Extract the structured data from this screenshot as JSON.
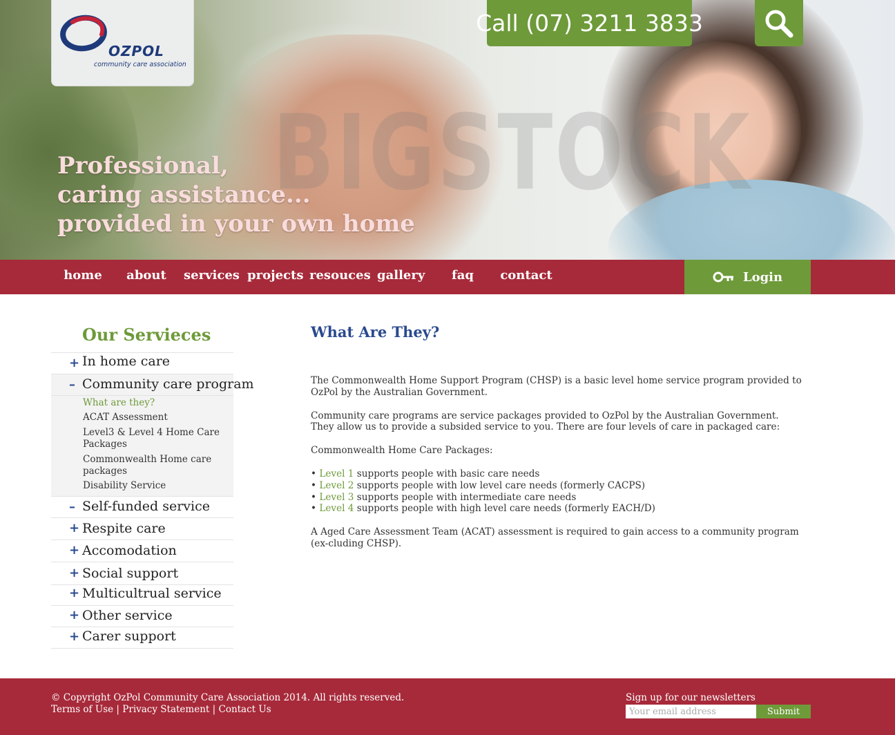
{
  "header": {
    "logo_name": "OZPOL",
    "logo_sub": "community care association",
    "call": "Call (07) 3211 3833",
    "watermark": "BIGSTOCK"
  },
  "hero": {
    "tagline": [
      "Professional,",
      "caring assistance...",
      "provided in your own home"
    ]
  },
  "nav": {
    "items": [
      "home",
      "about",
      "services",
      "projects",
      "resouces",
      "gallery",
      "faq",
      "contact"
    ],
    "login": "Login"
  },
  "sidebar": {
    "title": "Our Servieces",
    "items": [
      {
        "sign": "+",
        "label": "In home care"
      },
      {
        "sign": "–",
        "label": "Community care program"
      },
      {
        "sign": "–",
        "label": "Self-funded service"
      },
      {
        "sign": "+",
        "label": "Respite care"
      },
      {
        "sign": "+",
        "label": "Accomodation"
      },
      {
        "sign": "+",
        "label": "Social support"
      },
      {
        "sign": "+",
        "label": "Multicultrual service"
      },
      {
        "sign": "+",
        "label": "Other service"
      },
      {
        "sign": "+",
        "label": "Carer support"
      }
    ],
    "subitems": [
      "What are they?",
      "ACAT Assessment",
      "Level3 & Level 4 Home Care Packages",
      "Commonwealth Home care packages",
      "Disability Service"
    ]
  },
  "content": {
    "title": "What Are They?",
    "p1": "The Commonwealth Home Support Program (CHSP) is a basic level home service program provided to OzPol by the Australian Government.",
    "p2": "Community care programs are service packages provided to OzPol by the Australian Government.  They allow us to provide a subsided service to you.  There are four levels of care in packaged care:",
    "p3": "Commonwealth Home Care Packages:",
    "levels": [
      {
        "bullet": "• ",
        "level": "Level 1",
        "text": " supports people with basic care needs"
      },
      {
        "bullet": "• ",
        "level": "Level 2",
        "text": " supports people with low level care needs (formerly CACPS)"
      },
      {
        "bullet": "• ",
        "level": "Level 3",
        "text": " supports people with intermediate care needs"
      },
      {
        "bullet": "• ",
        "level": "Level 4",
        "text": " supports people with high level care needs (formerly EACH/D)"
      }
    ],
    "p4": "A Aged Care Assessment Team (ACAT) assessment is required to gain access to a community program (ex-cluding CHSP)."
  },
  "footer": {
    "copyright": "© Copyright OzPol Community Care Association 2014. All rights reserved.",
    "links": [
      "Terms of Use",
      "Privacy Statement",
      "Contact Us"
    ],
    "sep": " | ",
    "newsletter_label": "Sign up for our newsletters",
    "email_placeholder": "Your email address",
    "submit": "Submit"
  },
  "colors": {
    "brand_red": "#a72a3a",
    "brand_green": "#6e9a3a",
    "title_blue": "#2a4a8f"
  },
  "icons": {
    "search": "search-icon",
    "login": "key-icon",
    "expand": "plus-icon",
    "collapse": "minus-icon"
  }
}
